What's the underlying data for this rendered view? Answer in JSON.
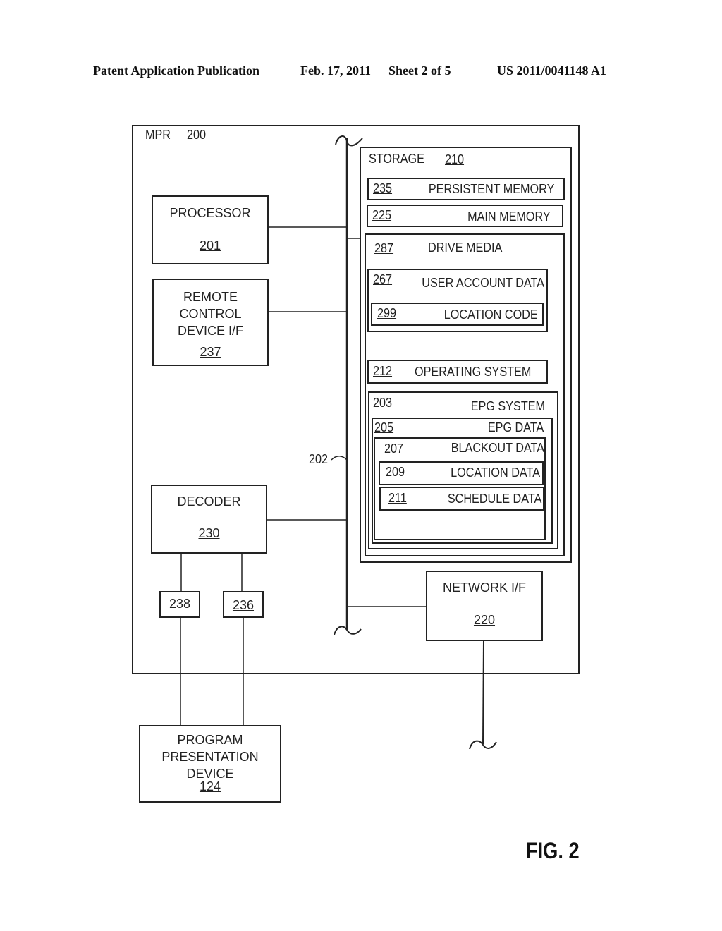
{
  "header": {
    "publication": "Patent Application Publication",
    "date": "Feb. 17, 2011",
    "sheet": "Sheet 2 of 5",
    "number": "US 2011/0041148 A1"
  },
  "figure_label": "FIG. 2",
  "mpr": {
    "name": "MPR",
    "ref": "200"
  },
  "bus": {
    "ref": "202"
  },
  "processor": {
    "name": "PROCESSOR",
    "ref": "201"
  },
  "remote": {
    "line1": "REMOTE",
    "line2": "CONTROL",
    "line3": "DEVICE I/F",
    "ref": "237"
  },
  "decoder": {
    "name": "DECODER",
    "ref": "230"
  },
  "port_238": {
    "ref": "238"
  },
  "port_236": {
    "ref": "236"
  },
  "network": {
    "name": "NETWORK I/F",
    "ref": "220"
  },
  "presentation": {
    "line1": "PROGRAM",
    "line2": "PRESENTATION",
    "line3": "DEVICE",
    "ref": "124"
  },
  "storage": {
    "name": "STORAGE",
    "ref": "210",
    "persistent": {
      "name": "PERSISTENT MEMORY",
      "ref": "235"
    },
    "main": {
      "name": "MAIN MEMORY",
      "ref": "225"
    },
    "drive": {
      "name": "DRIVE MEDIA",
      "ref": "287",
      "user_account": {
        "name": "USER ACCOUNT DATA",
        "ref": "267"
      },
      "location_code": {
        "name": "LOCATION CODE",
        "ref": "299"
      },
      "os": {
        "name": "OPERATING SYSTEM",
        "ref": "212"
      },
      "epg_system": {
        "name": "EPG SYSTEM",
        "ref": "203"
      },
      "epg_data": {
        "name": "EPG DATA",
        "ref": "205"
      },
      "blackout": {
        "name": "BLACKOUT DATA",
        "ref": "207"
      },
      "location_data": {
        "name": "LOCATION DATA",
        "ref": "209"
      },
      "schedule": {
        "name": "SCHEDULE DATA",
        "ref": "211"
      }
    }
  }
}
